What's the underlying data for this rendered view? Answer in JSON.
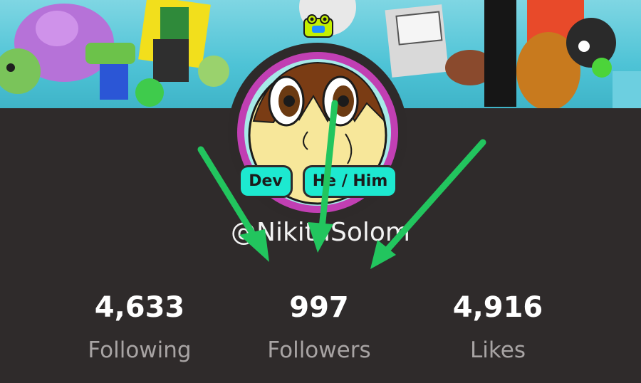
{
  "profile": {
    "badges": [
      {
        "label": "Dev"
      },
      {
        "label": "He / Him"
      }
    ],
    "username": "@NikitaSolom"
  },
  "stats": [
    {
      "value": "4,633",
      "label": "Following"
    },
    {
      "value": "997",
      "label": "Followers"
    },
    {
      "value": "4,916",
      "label": "Likes"
    }
  ],
  "colors": {
    "background": "#2f2b2b",
    "badge": "#1de9d0",
    "arrow": "#22c55e",
    "banner": "#4ec3d6",
    "avatar_ring": "#c13fb3"
  },
  "icons": {
    "avatar_hat": "frog-icon"
  }
}
